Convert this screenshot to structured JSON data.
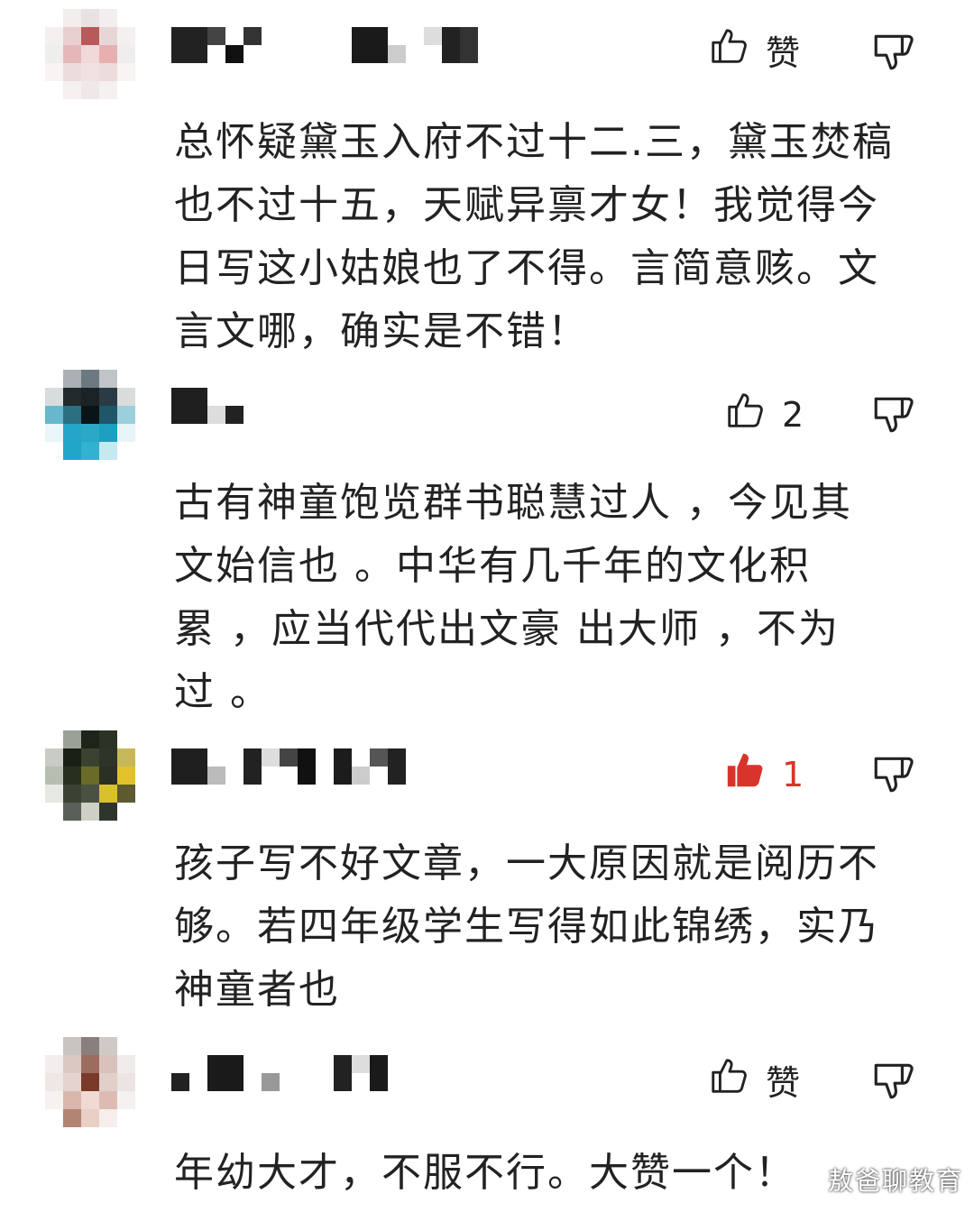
{
  "comments": [
    {
      "like_label": "赞",
      "text": "总怀疑黛玉入府不过十二.三，黛玉焚稿\n也不过十五，天赋异禀才女！我觉得今\n日写这小姑娘也了不得。言简意赅。文\n言文哪，确实是不错！",
      "liked": false
    },
    {
      "like_label": "2",
      "text": "古有神童饱览群书聪慧过人 ，今见其\n文始信也 。中华有几千年的文化积\n累 ，应当代代出文豪 出大师 ，不为\n过 。",
      "liked": false
    },
    {
      "like_label": "1",
      "text": "孩子写不好文章，一大原因就是阅历不\n够。若四年级学生写得如此锦绣，实乃\n神童者也",
      "liked": true
    },
    {
      "like_label": "赞",
      "text": "年幼大才，不服不行。大赞一个！",
      "liked": false
    }
  ],
  "watermark": "敖爸聊教育",
  "colors": {
    "liked_red": "#d9342b",
    "text": "#222222",
    "background": "#ffffff"
  }
}
